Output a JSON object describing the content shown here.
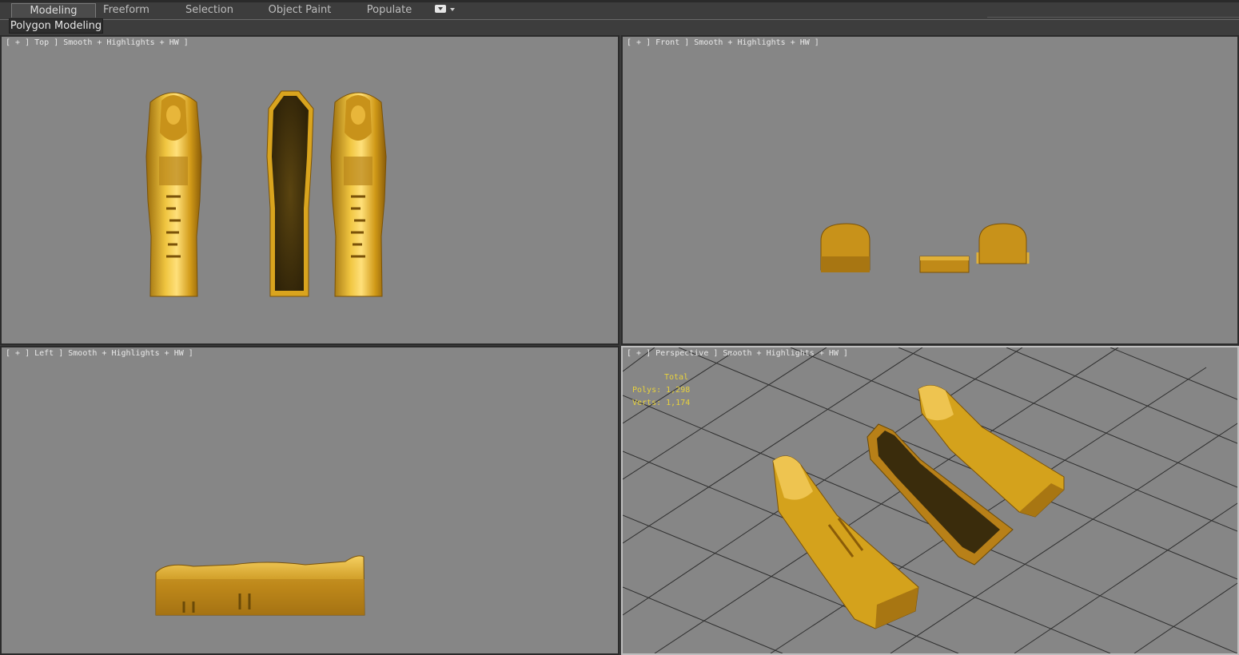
{
  "ribbon": {
    "tabs": [
      {
        "label": "Modeling",
        "active": true
      },
      {
        "label": "Freeform",
        "active": false
      },
      {
        "label": "Selection",
        "active": false
      },
      {
        "label": "Object Paint",
        "active": false
      },
      {
        "label": "Populate",
        "active": false
      }
    ],
    "panel_label": "Polygon Modeling",
    "options_icon": "dropdown-box-icon"
  },
  "viewports": {
    "top": {
      "label": "[ + ] Top ] Smooth + Highlights + HW ]"
    },
    "front": {
      "label": "[ + ] Front ] Smooth + Highlights + HW ]"
    },
    "left": {
      "label": "[ + ] Left ] Smooth + Highlights + HW ]"
    },
    "perspective": {
      "label": "[ + ] Perspective ] Smooth + Highlights + HW ]"
    }
  },
  "stats": {
    "total_label": "Total",
    "polys": "Polys: 1,298",
    "verts": "Verts: 1,174"
  },
  "colors": {
    "viewport_bg": "#868686",
    "gold": "#d4a21c",
    "gold_dark": "#8a6410",
    "stats_text": "#e8d23c",
    "grid": "#2e2e2e"
  }
}
